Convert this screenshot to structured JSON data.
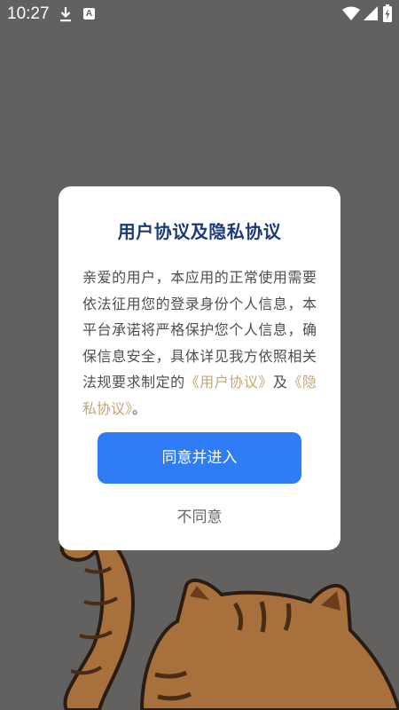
{
  "status_bar": {
    "time": "10:27",
    "icons": [
      "download-icon",
      "a-badge-icon",
      "wifi-icon",
      "signal-icon",
      "battery-charging-icon"
    ],
    "a_badge_letter": "A"
  },
  "dialog": {
    "title": "用户协议及隐私协议",
    "body_text": "亲爱的用户，本应用的正常使用需要依法征用您的登录身份个人信息，本平台承诺将严格保护您个人信息，确保信息安全，具体详见我方依照相关法规要求制定的",
    "user_agreement_link": "《用户协议》",
    "conjunction": "及",
    "privacy_agreement_link": "《隐私协议》",
    "ending": "。",
    "agree_button": "同意并进入",
    "disagree_button": "不同意"
  },
  "colors": {
    "overlay_background": "#626160",
    "title": "#1c3a78",
    "body_text": "#4f4f4f",
    "link": "#c3a57a",
    "agree_button_bg": "#2e7cf6",
    "disagree_text": "#666666",
    "cat_fur": "#a8703c",
    "cat_outline": "#2a1c10"
  }
}
